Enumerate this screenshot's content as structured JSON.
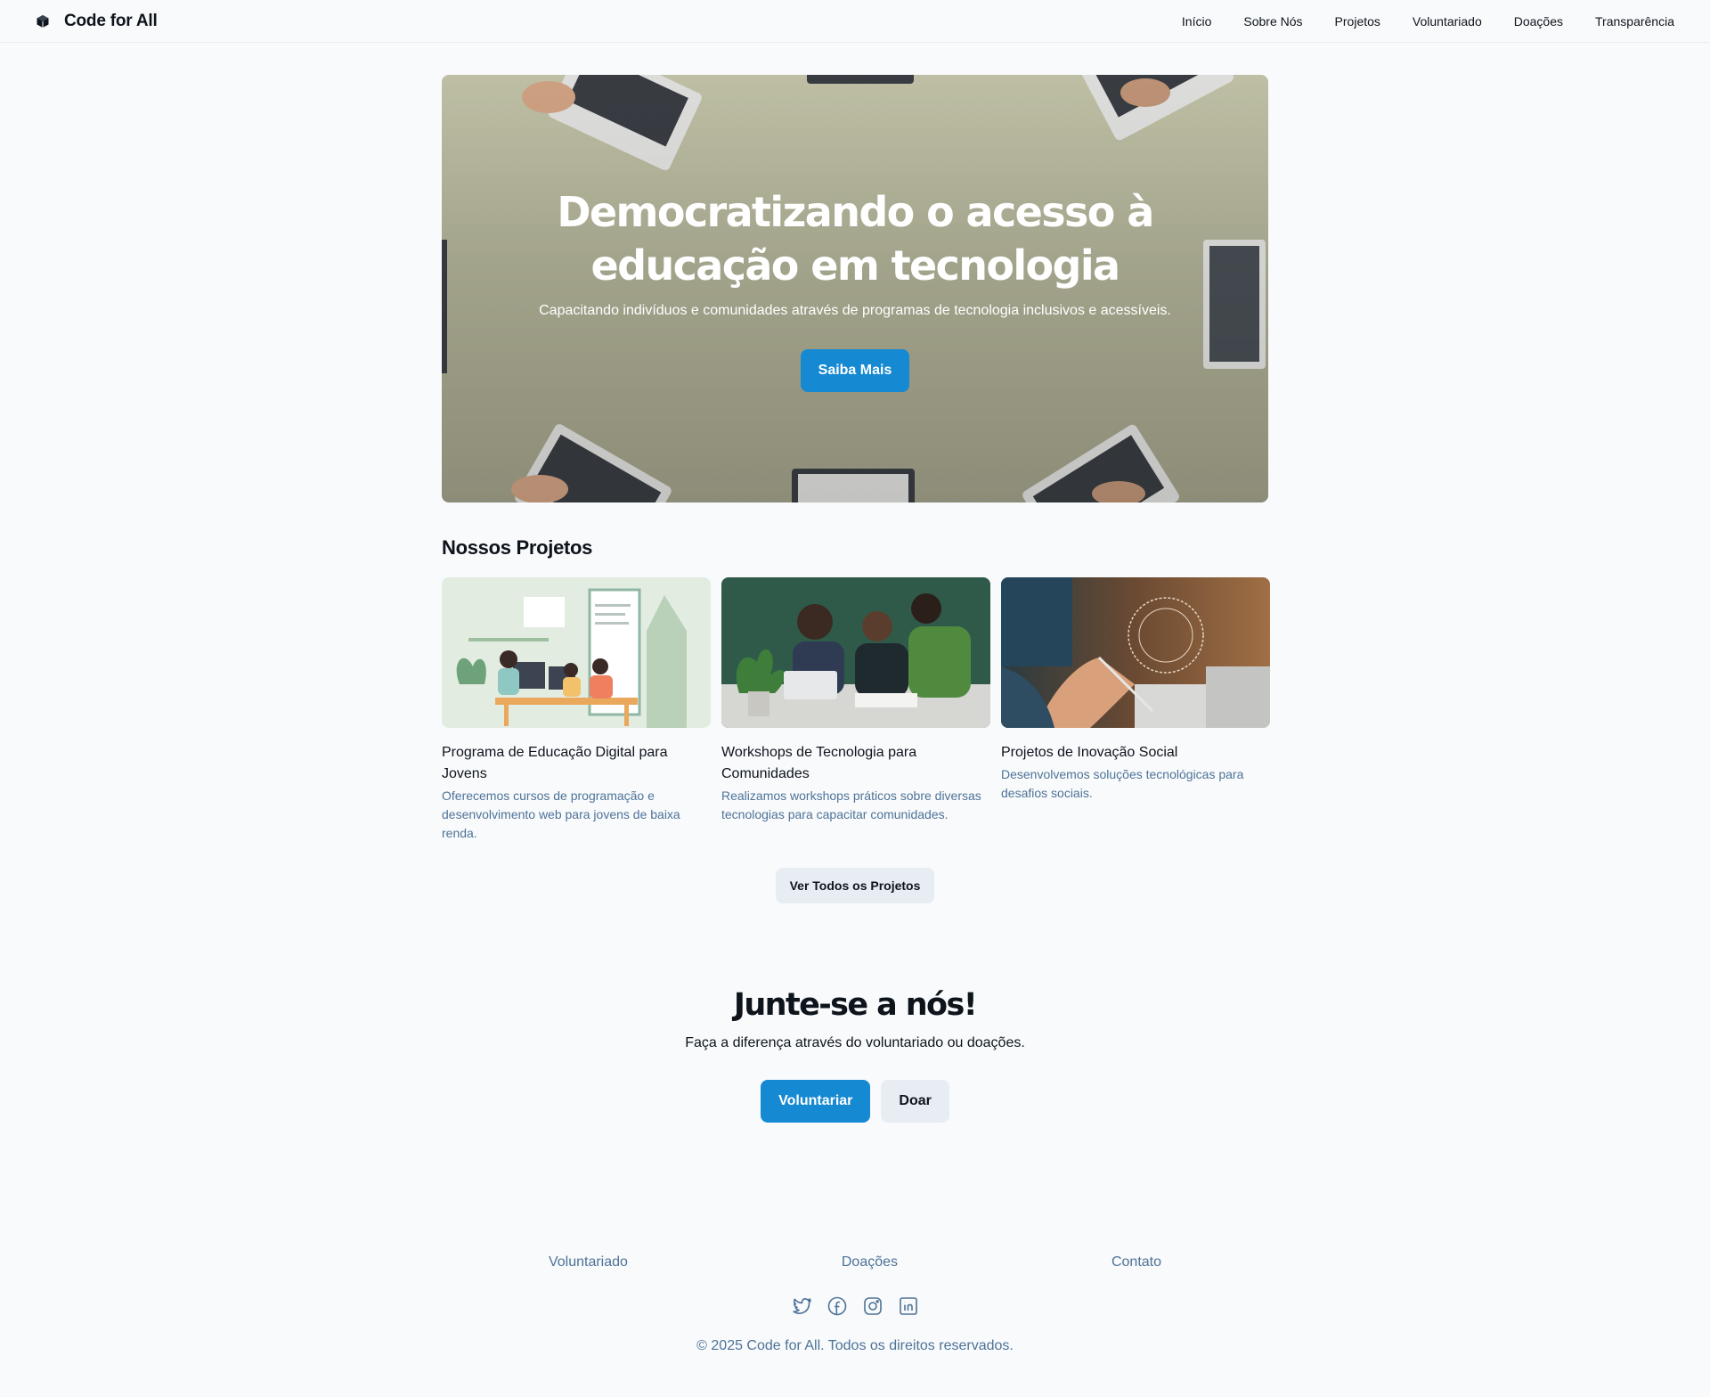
{
  "brand": {
    "name": "Code for All",
    "icon": "cube-logo-icon"
  },
  "nav": {
    "items": [
      "Início",
      "Sobre Nós",
      "Projetos",
      "Voluntariado",
      "Doações",
      "Transparência"
    ]
  },
  "hero": {
    "title": "Democratizando o acesso à educação em tecnologia",
    "subtitle": "Capacitando indivíduos e comunidades através de programas de tecnologia inclusivos e acessíveis.",
    "cta": "Saiba Mais"
  },
  "projects": {
    "title": "Nossos Projetos",
    "items": [
      {
        "title": "Programa de Educação Digital para Jovens",
        "description": "Oferecemos cursos de programação e desenvolvimento web para jovens de baixa renda."
      },
      {
        "title": "Workshops de Tecnologia para Comunidades",
        "description": "Realizamos workshops práticos sobre diversas tecnologias para capacitar comunidades."
      },
      {
        "title": "Projetos de Inovação Social",
        "description": "Desenvolvemos soluções tecnológicas para desafios sociais."
      }
    ],
    "view_all": "Ver Todos os Projetos"
  },
  "join": {
    "title": "Junte-se a nós!",
    "subtitle": "Faça a diferença através do voluntariado ou doações.",
    "volunteer": "Voluntariar",
    "donate": "Doar"
  },
  "footer": {
    "links": [
      "Voluntariado",
      "Doações",
      "Contato"
    ],
    "socials": [
      "twitter-icon",
      "facebook-icon",
      "instagram-icon",
      "linkedin-icon"
    ],
    "copyright": "© 2025 Code for All. Todos os direitos reservados."
  },
  "colors": {
    "accent": "#1589d2",
    "text": "#0e141b",
    "muted": "#4e7397",
    "secondary_bg": "#e7edf3",
    "page_bg": "#f8fafc"
  }
}
